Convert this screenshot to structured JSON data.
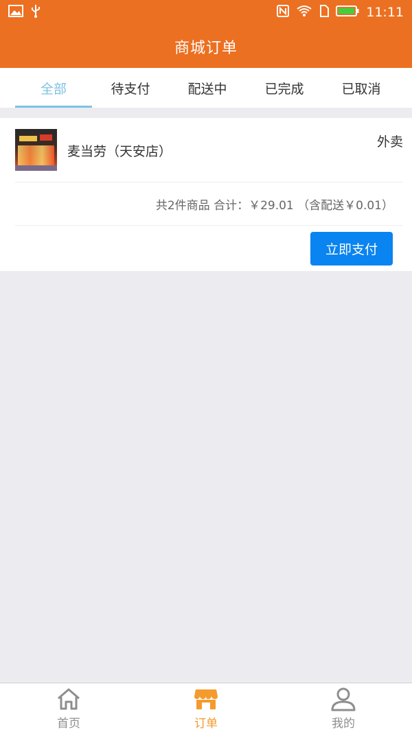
{
  "status_bar": {
    "time": "11:11",
    "icons_left": [
      "image-icon",
      "usb-icon"
    ],
    "icons_right": [
      "nfc-icon",
      "wifi-icon",
      "sim-icon",
      "battery-icon"
    ]
  },
  "header": {
    "title": "商城订单"
  },
  "tabs": [
    {
      "label": "全部",
      "active": true
    },
    {
      "label": "待支付",
      "active": false
    },
    {
      "label": "配送中",
      "active": false
    },
    {
      "label": "已完成",
      "active": false
    },
    {
      "label": "已取消",
      "active": false
    }
  ],
  "order": {
    "shop_name": "麦当劳（天安店）",
    "order_type": "外卖",
    "summary": "共2件商品 合计：￥29.01 （含配送￥0.01）",
    "pay_label": "立即支付"
  },
  "bottom_nav": [
    {
      "label": "首页",
      "icon": "home-icon",
      "active": false
    },
    {
      "label": "订单",
      "icon": "shop-icon",
      "active": true
    },
    {
      "label": "我的",
      "icon": "user-icon",
      "active": false
    }
  ],
  "colors": {
    "brand_orange": "#ec7021",
    "tab_active": "#7cc3e0",
    "pay_button": "#0a84f0",
    "nav_active": "#f59a2c"
  }
}
